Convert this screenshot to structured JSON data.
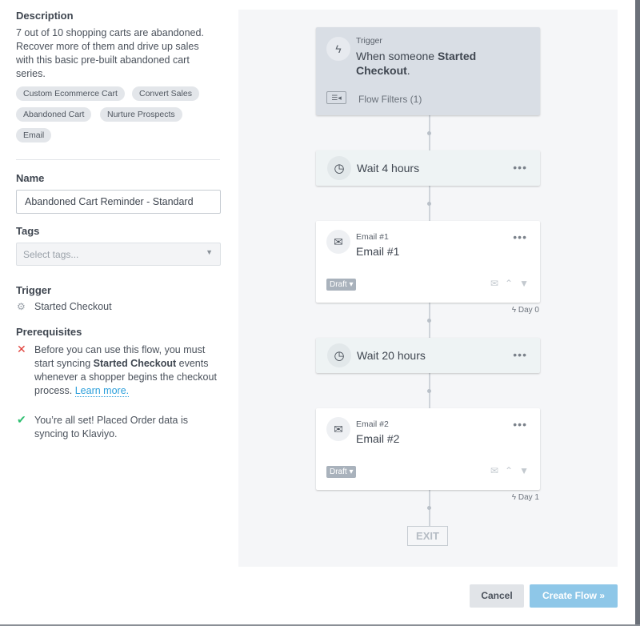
{
  "left": {
    "description_label": "Description",
    "description": "7 out of 10 shopping carts are abandoned. Recover more of them and drive up sales with this basic pre-built abandoned cart series.",
    "tags": [
      "Custom Ecommerce Cart",
      "Convert Sales",
      "Abandoned Cart",
      "Nurture Prospects",
      "Email"
    ],
    "name_label": "Name",
    "name_value": "Abandoned Cart Reminder - Standard",
    "tags_label": "Tags",
    "tags_placeholder": "Select tags...",
    "trigger_label": "Trigger",
    "trigger_value": "Started Checkout",
    "prereq_label": "Prerequisites",
    "prereq_fail_pre": "Before you can use this flow, you must start syncing ",
    "prereq_fail_bold": "Started Checkout",
    "prereq_fail_post": " events whenever a shopper begins the checkout process. ",
    "learn_more": "Learn more.",
    "prereq_ok": "You’re all set! Placed Order data is syncing to Klaviyo."
  },
  "flow": {
    "trigger_label": "Trigger",
    "trigger_pre": "When someone ",
    "trigger_bold": "Started Checkout",
    "trigger_post": ".",
    "filters": "Flow Filters (1)",
    "wait1": "Wait 4 hours",
    "email1_small": "Email #1",
    "email1_title": "Email #1",
    "email1_status": "Draft",
    "day0": "Day 0",
    "wait2": "Wait 20 hours",
    "email2_small": "Email #2",
    "email2_title": "Email #2",
    "email2_status": "Draft",
    "day1": "Day 1",
    "exit": "EXIT",
    "more": "•••"
  },
  "footer": {
    "cancel": "Cancel",
    "create": "Create Flow »"
  },
  "colors": {
    "accent": "#8ec7e8",
    "error": "#e0403a",
    "success": "#2fbf71",
    "link": "#2c9fdb"
  }
}
